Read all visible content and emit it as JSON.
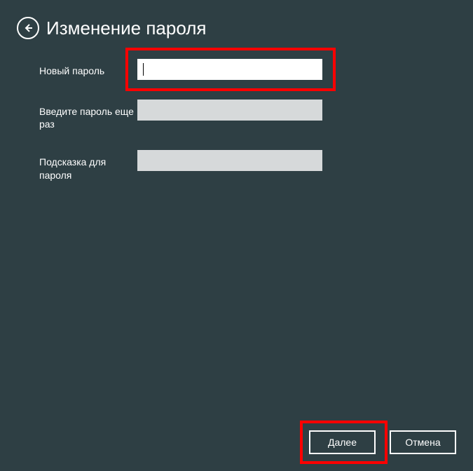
{
  "header": {
    "title": "Изменение пароля"
  },
  "form": {
    "newPassword": {
      "label": "Новый пароль",
      "value": ""
    },
    "confirmPassword": {
      "label": "Введите пароль еще раз",
      "value": ""
    },
    "hint": {
      "label": "Подсказка для пароля",
      "value": ""
    }
  },
  "buttons": {
    "next": "Далее",
    "cancel": "Отмена"
  }
}
